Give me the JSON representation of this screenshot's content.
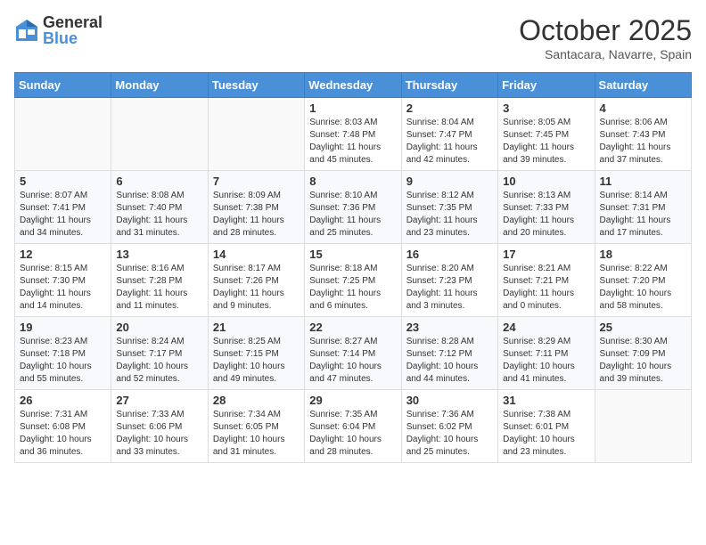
{
  "header": {
    "logo_general": "General",
    "logo_blue": "Blue",
    "month_title": "October 2025",
    "location": "Santacara, Navarre, Spain"
  },
  "weekdays": [
    "Sunday",
    "Monday",
    "Tuesday",
    "Wednesday",
    "Thursday",
    "Friday",
    "Saturday"
  ],
  "weeks": [
    [
      {
        "day": "",
        "info": ""
      },
      {
        "day": "",
        "info": ""
      },
      {
        "day": "",
        "info": ""
      },
      {
        "day": "1",
        "info": "Sunrise: 8:03 AM\nSunset: 7:48 PM\nDaylight: 11 hours\nand 45 minutes."
      },
      {
        "day": "2",
        "info": "Sunrise: 8:04 AM\nSunset: 7:47 PM\nDaylight: 11 hours\nand 42 minutes."
      },
      {
        "day": "3",
        "info": "Sunrise: 8:05 AM\nSunset: 7:45 PM\nDaylight: 11 hours\nand 39 minutes."
      },
      {
        "day": "4",
        "info": "Sunrise: 8:06 AM\nSunset: 7:43 PM\nDaylight: 11 hours\nand 37 minutes."
      }
    ],
    [
      {
        "day": "5",
        "info": "Sunrise: 8:07 AM\nSunset: 7:41 PM\nDaylight: 11 hours\nand 34 minutes."
      },
      {
        "day": "6",
        "info": "Sunrise: 8:08 AM\nSunset: 7:40 PM\nDaylight: 11 hours\nand 31 minutes."
      },
      {
        "day": "7",
        "info": "Sunrise: 8:09 AM\nSunset: 7:38 PM\nDaylight: 11 hours\nand 28 minutes."
      },
      {
        "day": "8",
        "info": "Sunrise: 8:10 AM\nSunset: 7:36 PM\nDaylight: 11 hours\nand 25 minutes."
      },
      {
        "day": "9",
        "info": "Sunrise: 8:12 AM\nSunset: 7:35 PM\nDaylight: 11 hours\nand 23 minutes."
      },
      {
        "day": "10",
        "info": "Sunrise: 8:13 AM\nSunset: 7:33 PM\nDaylight: 11 hours\nand 20 minutes."
      },
      {
        "day": "11",
        "info": "Sunrise: 8:14 AM\nSunset: 7:31 PM\nDaylight: 11 hours\nand 17 minutes."
      }
    ],
    [
      {
        "day": "12",
        "info": "Sunrise: 8:15 AM\nSunset: 7:30 PM\nDaylight: 11 hours\nand 14 minutes."
      },
      {
        "day": "13",
        "info": "Sunrise: 8:16 AM\nSunset: 7:28 PM\nDaylight: 11 hours\nand 11 minutes."
      },
      {
        "day": "14",
        "info": "Sunrise: 8:17 AM\nSunset: 7:26 PM\nDaylight: 11 hours\nand 9 minutes."
      },
      {
        "day": "15",
        "info": "Sunrise: 8:18 AM\nSunset: 7:25 PM\nDaylight: 11 hours\nand 6 minutes."
      },
      {
        "day": "16",
        "info": "Sunrise: 8:20 AM\nSunset: 7:23 PM\nDaylight: 11 hours\nand 3 minutes."
      },
      {
        "day": "17",
        "info": "Sunrise: 8:21 AM\nSunset: 7:21 PM\nDaylight: 11 hours\nand 0 minutes."
      },
      {
        "day": "18",
        "info": "Sunrise: 8:22 AM\nSunset: 7:20 PM\nDaylight: 10 hours\nand 58 minutes."
      }
    ],
    [
      {
        "day": "19",
        "info": "Sunrise: 8:23 AM\nSunset: 7:18 PM\nDaylight: 10 hours\nand 55 minutes."
      },
      {
        "day": "20",
        "info": "Sunrise: 8:24 AM\nSunset: 7:17 PM\nDaylight: 10 hours\nand 52 minutes."
      },
      {
        "day": "21",
        "info": "Sunrise: 8:25 AM\nSunset: 7:15 PM\nDaylight: 10 hours\nand 49 minutes."
      },
      {
        "day": "22",
        "info": "Sunrise: 8:27 AM\nSunset: 7:14 PM\nDaylight: 10 hours\nand 47 minutes."
      },
      {
        "day": "23",
        "info": "Sunrise: 8:28 AM\nSunset: 7:12 PM\nDaylight: 10 hours\nand 44 minutes."
      },
      {
        "day": "24",
        "info": "Sunrise: 8:29 AM\nSunset: 7:11 PM\nDaylight: 10 hours\nand 41 minutes."
      },
      {
        "day": "25",
        "info": "Sunrise: 8:30 AM\nSunset: 7:09 PM\nDaylight: 10 hours\nand 39 minutes."
      }
    ],
    [
      {
        "day": "26",
        "info": "Sunrise: 7:31 AM\nSunset: 6:08 PM\nDaylight: 10 hours\nand 36 minutes."
      },
      {
        "day": "27",
        "info": "Sunrise: 7:33 AM\nSunset: 6:06 PM\nDaylight: 10 hours\nand 33 minutes."
      },
      {
        "day": "28",
        "info": "Sunrise: 7:34 AM\nSunset: 6:05 PM\nDaylight: 10 hours\nand 31 minutes."
      },
      {
        "day": "29",
        "info": "Sunrise: 7:35 AM\nSunset: 6:04 PM\nDaylight: 10 hours\nand 28 minutes."
      },
      {
        "day": "30",
        "info": "Sunrise: 7:36 AM\nSunset: 6:02 PM\nDaylight: 10 hours\nand 25 minutes."
      },
      {
        "day": "31",
        "info": "Sunrise: 7:38 AM\nSunset: 6:01 PM\nDaylight: 10 hours\nand 23 minutes."
      },
      {
        "day": "",
        "info": ""
      }
    ]
  ]
}
